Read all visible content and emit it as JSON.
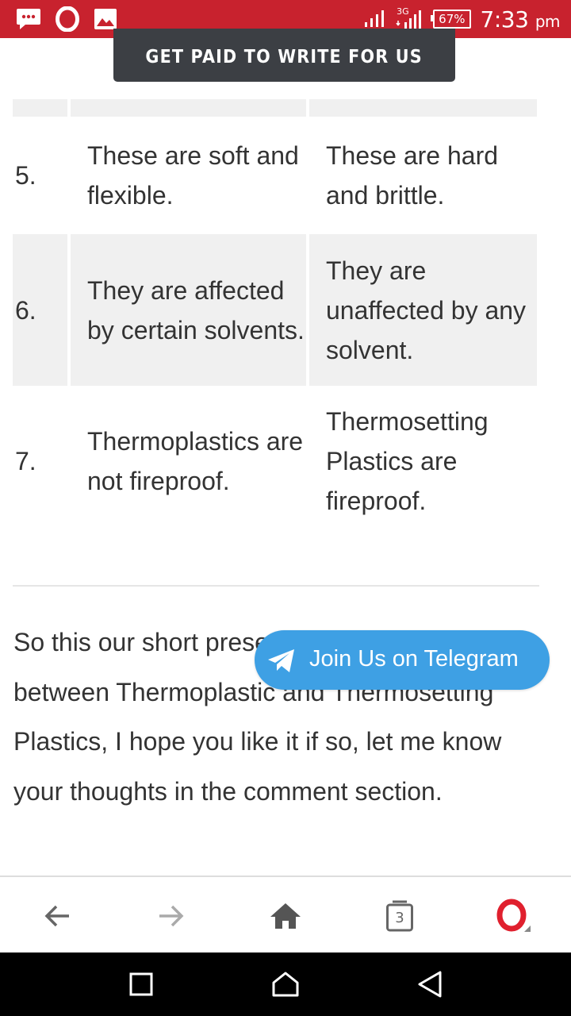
{
  "status_bar": {
    "time": "7:33",
    "ampm": "pm",
    "battery": "67%",
    "network": "3G",
    "icons": [
      "message-icon",
      "opera-notification-icon",
      "image-icon",
      "signal-icon",
      "signal-3g-icon",
      "battery-icon"
    ]
  },
  "cta": {
    "label": "GET PAID TO WRITE FOR US"
  },
  "table": {
    "rows": [
      {
        "num": "5.",
        "thermoplastic": "These are soft and flexible.",
        "thermosetting": "These are hard and brittle."
      },
      {
        "num": "6.",
        "thermoplastic": "They are affected by certain solvents.",
        "thermosetting": "They are unaffected by any solvent."
      },
      {
        "num": "7.",
        "thermoplastic": "Thermoplastics are not fireproof.",
        "thermosetting": "Thermosetting Plastics are fireproof."
      }
    ]
  },
  "article": {
    "paragraph": "So this our short presentation on the difference between Thermoplastic and Thermosetting Plastics, I hope you like it if so, let me know your thoughts in the comment section."
  },
  "telegram": {
    "label": "Join Us on Telegram"
  },
  "toolbar": {
    "tab_count": "3",
    "icons": [
      "back-icon",
      "forward-icon",
      "home-icon",
      "tabs-icon",
      "opera-menu-icon"
    ]
  },
  "colors": {
    "status_bar": "#c8222e",
    "cta_bg": "#3c3f44",
    "telegram": "#3ea0e4",
    "text": "#333333",
    "table_shade": "#f0f0f0"
  }
}
